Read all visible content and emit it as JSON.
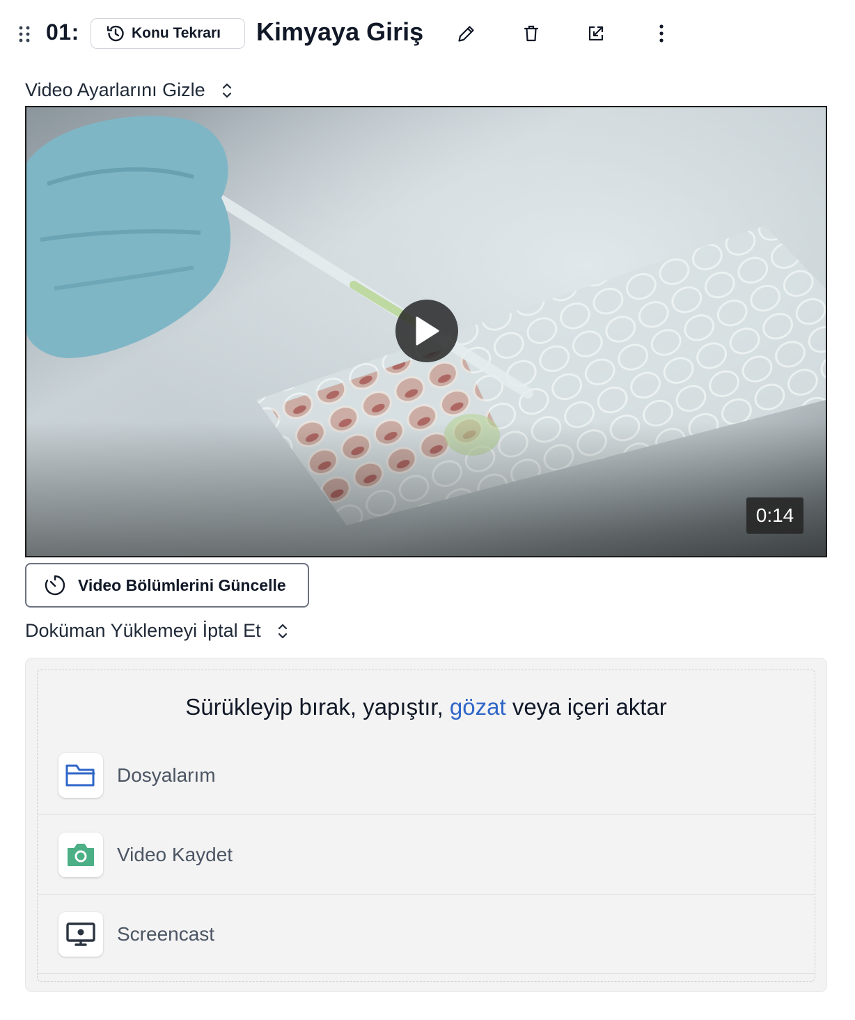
{
  "header": {
    "lesson_number": "01:",
    "tag_label": "Konu Tekrarı",
    "title": "Kimyaya Giriş",
    "icons": [
      "drag-handle-icon",
      "history-icon",
      "pencil-icon",
      "trash-icon",
      "external-link-icon",
      "more-vertical-icon"
    ]
  },
  "video_settings": {
    "toggle_label": "Video Ayarlarını Gizle",
    "duration": "0:14",
    "update_chapters_label": "Video Bölümlerini Güncelle"
  },
  "document_upload": {
    "toggle_label": "Doküman Yüklemeyi İptal Et",
    "drop_text_before": "Sürükleyip bırak, yapıştır, ",
    "drop_text_link": "gözat",
    "drop_text_after": " veya içeri aktar",
    "sources": [
      {
        "label": "Dosyalarım",
        "icon": "folder-icon",
        "color": "#2f66c8"
      },
      {
        "label": "Video Kaydet",
        "icon": "camera-icon",
        "color": "#4caf86"
      },
      {
        "label": "Screencast",
        "icon": "screencast-icon",
        "color": "#2b3440"
      }
    ]
  },
  "colors": {
    "link": "#2f66c8",
    "text": "#111827",
    "panel_bg": "#f3f3f3"
  }
}
